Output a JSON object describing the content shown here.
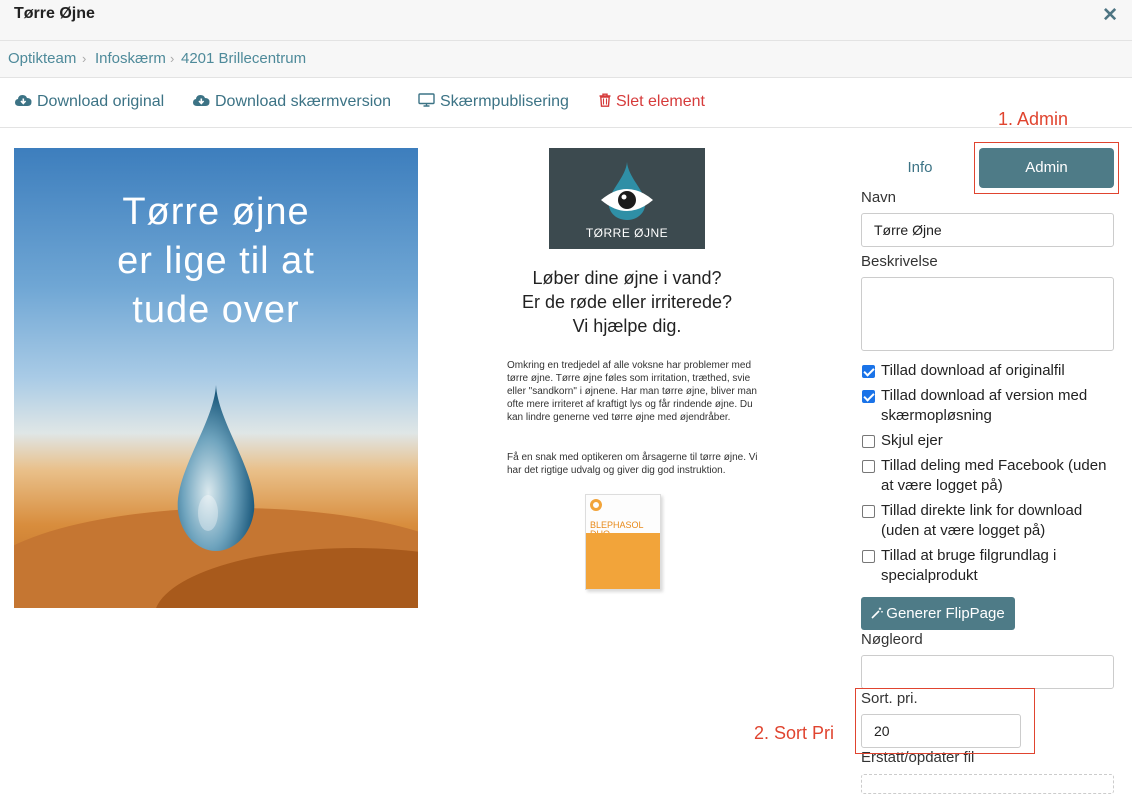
{
  "modal": {
    "title": "Tørre Øjne",
    "close_glyph": "✕"
  },
  "breadcrumb": [
    "Optikteam",
    "Infoskærm",
    "4201 Brillecentrum"
  ],
  "toolbar": {
    "download_original": "Download original",
    "download_screen": "Download skærmversion",
    "screen_publish": "Skærmpublisering",
    "delete": "Slet element"
  },
  "poster": {
    "headline": [
      "Tørre øjne",
      "er lige til at",
      "tude over"
    ]
  },
  "ad": {
    "logo_text": "TØRRE ØJNE",
    "lead": [
      "Løber dine øjne i vand?",
      "Er de røde eller irriterede?",
      "Vi hjælpe dig."
    ],
    "body1": "Omkring en tredjedel af alle voksne har problemer med tørre øjne. Tørre øjne føles som irritation, træthed, svie eller \"sandkorn\" i øjnene. Har man tørre øjne, bliver man ofte mere irriteret af kraftigt lys og får rindende øjne. Du kan lindre generne ved tørre øjne med øjendråber.",
    "body2": "Få en snak med optikeren om årsagerne til tørre øjne. Vi har det rigtige udvalg og giver dig god instruktion.",
    "product_brand": "BLEPHASOL DUO"
  },
  "tabs": {
    "info": "Info",
    "admin": "Admin"
  },
  "form": {
    "name_label": "Navn",
    "name_value": "Tørre Øjne",
    "description_label": "Beskrivelse",
    "checkboxes": [
      {
        "label": "Tillad download af originalfil",
        "checked": true
      },
      {
        "label": "Tillad download af version med skærmopløsning",
        "checked": true
      },
      {
        "label": "Skjul ejer",
        "checked": false
      },
      {
        "label": "Tillad deling med Facebook (uden at være logget på)",
        "checked": false
      },
      {
        "label": "Tillad direkte link for download (uden at være logget på)",
        "checked": false
      },
      {
        "label": "Tillad at bruge filgrundlag i specialprodukt",
        "checked": false
      }
    ],
    "flip_button": "Generer FlipPage",
    "keywords_label": "Nøgleord",
    "keywords_value": "",
    "sort_label": "Sort. pri.",
    "sort_value": "20",
    "replace_label": "Erstatt/opdater fil"
  },
  "annotations": {
    "admin_note": "1. Admin",
    "sort_note": "2. Sort Pri",
    "color": "#e0442f"
  },
  "colors": {
    "accent": "#4e7b87",
    "link": "#3c7385",
    "danger": "#d63b3b"
  }
}
